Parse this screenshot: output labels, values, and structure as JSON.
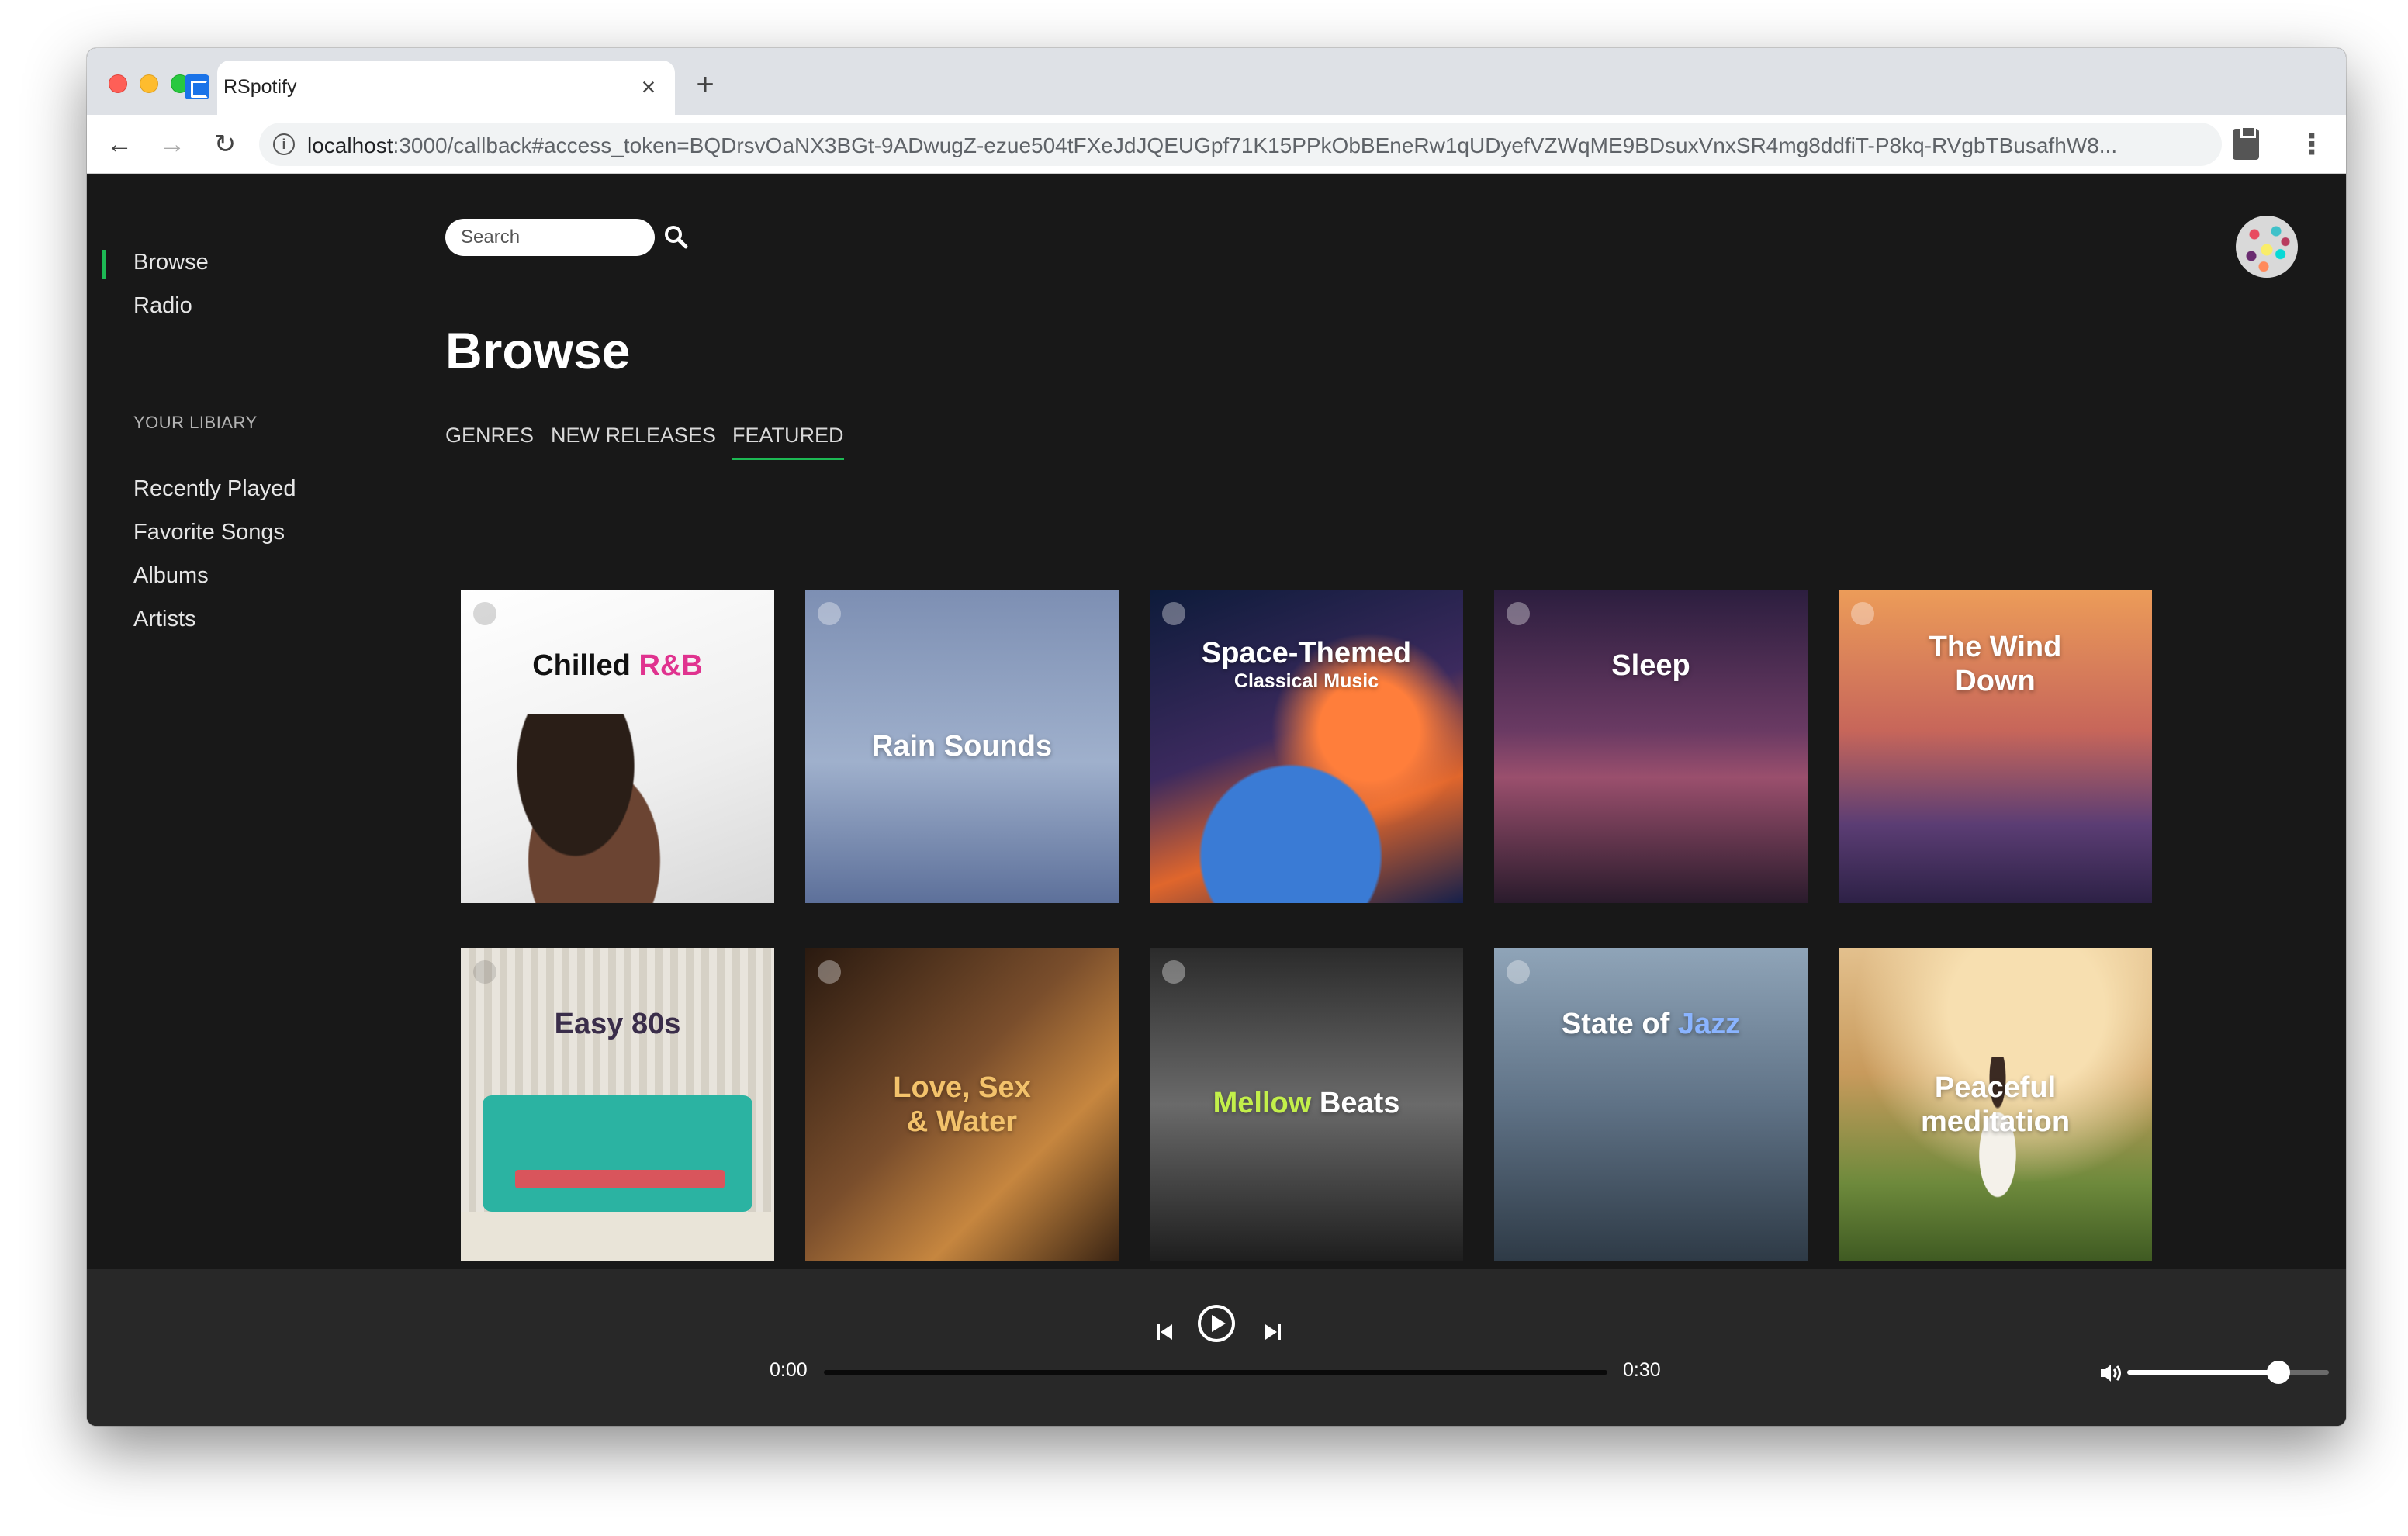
{
  "browser": {
    "tab_title": "RSpotify",
    "tab_close": "×",
    "new_tab": "+",
    "url_host": "localhost",
    "url_path": ":3000/callback#access_token=BQDrsvOaNX3BGt-9ADwugZ-ezue504tFXeJdJQEUGpf71K15PPkObBEneRw1qUDyefVZWqME9BDsuxVnxSR4mg8ddfiT-P8kq-RVgbTBusafhW8...",
    "back_icon": "←",
    "forward_icon": "→",
    "reload_icon": "↻",
    "menu_icon": "⋮"
  },
  "sidebar": {
    "nav": [
      {
        "label": "Browse",
        "active": true
      },
      {
        "label": "Radio",
        "active": false
      }
    ],
    "library_heading": "YOUR LIBIARY",
    "library": [
      {
        "label": "Recently Played"
      },
      {
        "label": "Favorite Songs"
      },
      {
        "label": "Albums"
      },
      {
        "label": "Artists"
      }
    ]
  },
  "header": {
    "search_placeholder": "Search"
  },
  "main": {
    "title": "Browse",
    "tabs": [
      {
        "label": "GENRES",
        "active": false
      },
      {
        "label": "NEW RELEASES",
        "active": false
      },
      {
        "label": "FEATURED",
        "active": true
      }
    ],
    "playlists": [
      {
        "title": "Chilled",
        "title_accent": "R&B",
        "subtitle": ""
      },
      {
        "title": "Rain Sounds",
        "title_accent": "",
        "subtitle": ""
      },
      {
        "title": "Space-Themed",
        "title_accent": "",
        "subtitle": "Classical Music"
      },
      {
        "title": "Sleep",
        "title_accent": "",
        "subtitle": ""
      },
      {
        "title": "The Wind Down",
        "title_accent": "",
        "subtitle": ""
      },
      {
        "title": "Easy 80s",
        "title_accent": "",
        "subtitle": ""
      },
      {
        "title": "Love, Sex & Water",
        "title_accent": "",
        "subtitle": ""
      },
      {
        "title": "Mellow",
        "title_accent": "Beats",
        "subtitle": ""
      },
      {
        "title": "State of",
        "title_accent": "Jazz",
        "subtitle": ""
      },
      {
        "title": "Peaceful meditation",
        "title_accent": "",
        "subtitle": ""
      }
    ]
  },
  "player": {
    "current_time": "0:00",
    "duration": "0:30",
    "progress": 0,
    "volume": 0.75
  },
  "colors": {
    "accent": "#1db954",
    "background": "#181818",
    "player_bg": "#282828",
    "rnb_pink": "#e0338f",
    "mellow_green": "#c3f04a",
    "jazz_blue": "#8ab4ff"
  }
}
